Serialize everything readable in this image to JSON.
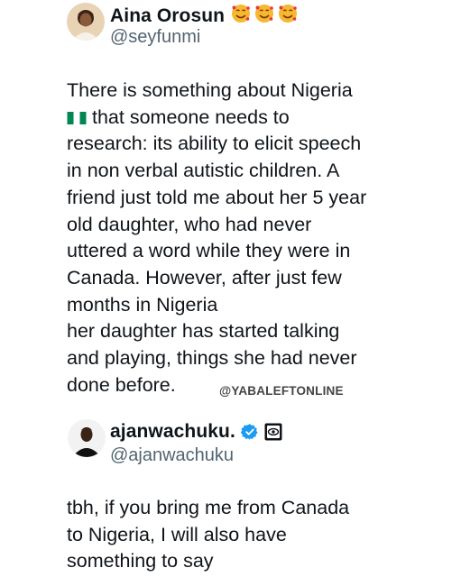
{
  "post1": {
    "display_name": "Aina Orosun",
    "handle": "@seyfunmi",
    "name_emojis": "smiling-face-with-hearts-icon x3",
    "lines": [
      "There is something about Nigeria",
      "that someone needs to",
      "research: its ability to elicit speech",
      "in non verbal autistic children. A",
      "friend just told me about her 5 year",
      "old daughter, who had never",
      "uttered a word while they were in",
      "Canada. However, after just few",
      "months in Nigeria",
      "her daughter has started talking",
      "and playing, things she had never",
      "done before."
    ]
  },
  "watermark": "@YABALEFTONLINE",
  "post2": {
    "display_name": "ajanwachuku.",
    "handle": "@ajanwachuku",
    "lines": [
      "tbh, if you bring me from Canada",
      "to Nigeria, I will also have",
      "something to say"
    ]
  },
  "colors": {
    "text": "#0f1419",
    "handle": "#536471",
    "verified": "#1d9bf0",
    "nigeria_green": "#008751"
  }
}
